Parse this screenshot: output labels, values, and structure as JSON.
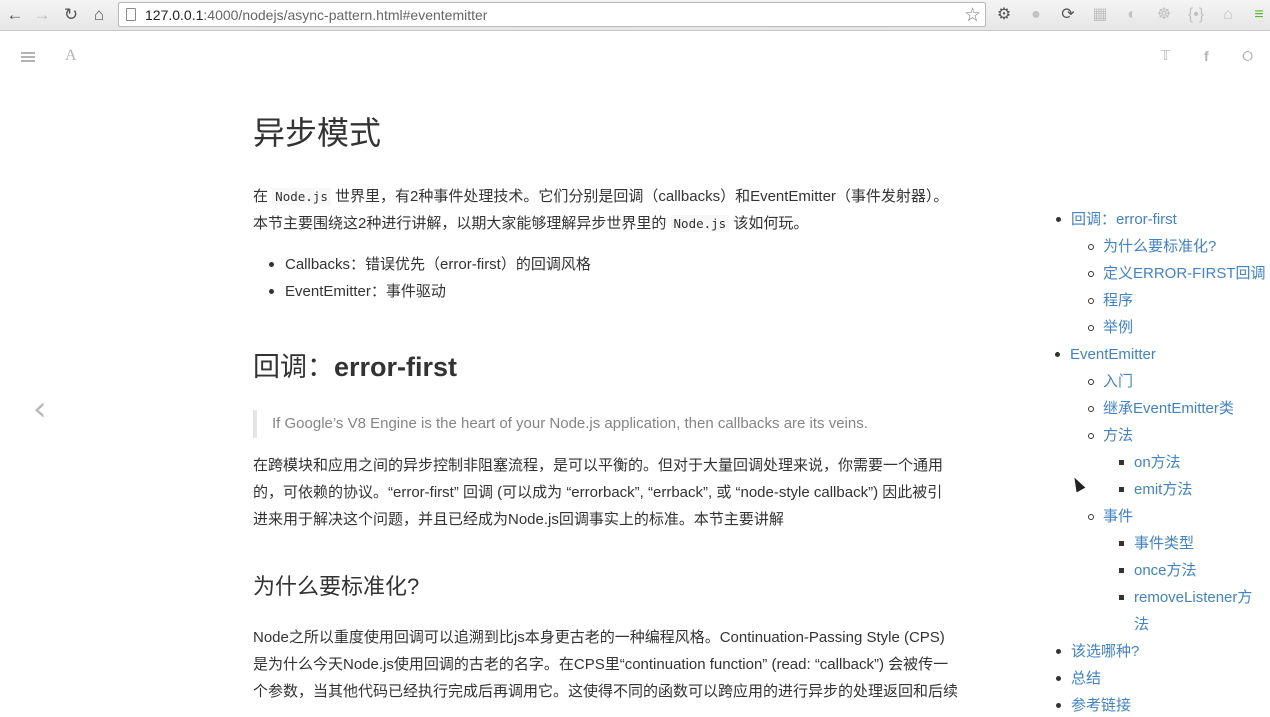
{
  "browser": {
    "url_host": "127.0.0.1",
    "url_rest": ":4000/nodejs/async-pattern.html#eventemitter",
    "nav_icons": [
      "back-arrow-icon",
      "forward-arrow-icon",
      "reload-icon",
      "home-icon"
    ],
    "extension_icons": [
      "gear-icon",
      "globe-icon",
      "sync-icon",
      "table-icon",
      "puzzle-icon",
      "settings-icon",
      "braces-icon",
      "hat-icon",
      "menu-icon"
    ]
  },
  "toolbar": {
    "left_icons": [
      "hamburger-menu-icon",
      "font-settings-icon"
    ],
    "right_icons": [
      "twitter-icon",
      "facebook-icon",
      "share-icon"
    ]
  },
  "article": {
    "title": "异步模式",
    "intro": {
      "line1_a": "在 ",
      "line1_code": "Node.js",
      "line1_b": " 世界里，有2种事件处理技术。它们分别是回调（callbacks）和EventEmitter（事件发射器）。",
      "line2_a": "本节主要围绕这2种进行讲解，以期大家能够理解异步世界里的 ",
      "line2_code": "Node.js",
      "line2_b": " 该如何玩。"
    },
    "bullets": [
      "Callbacks：错误优先（error-first）的回调风格",
      "EventEmitter：事件驱动"
    ],
    "section_heading_cn": "回调：",
    "section_heading_en": "error-first",
    "quote": "If Google’s V8 Engine is the heart of your Node.js application, then callbacks are its veins.",
    "para1": [
      "在跨模块和应用之间的异步控制非阻塞流程，是可以平衡的。但对于大量回调处理来说，你需要一个通用",
      "的，可依赖的协议。“error-first” 回调 (可以成为 “errorback”, “errback”, 或 “node-style callback”) 因此被引",
      "进来用于解决这个问题，并且已经成为Node.js回调事实上的标准。本节主要讲解"
    ],
    "subheading": "为什么要标准化?",
    "para2": [
      "Node之所以重度使用回调可以追溯到比js本身更古老的一种编程风格。Continuation-Passing Style (CPS)",
      "是为什么今天Node.js使用回调的古老的名字。在CPS里“continuation function” (read: “callback”) 会被传一",
      "个参数，当其他代码已经执行完成后再调用它。这使得不同的函数可以跨应用的进行异步的处理返回和后续"
    ]
  },
  "toc": [
    {
      "label": "回调：error-first",
      "level": 1
    },
    {
      "label": "为什么要标准化?",
      "level": 2
    },
    {
      "label": "定义ERROR-FIRST回调",
      "level": 2
    },
    {
      "label": "程序",
      "level": 2
    },
    {
      "label": "举例",
      "level": 2
    },
    {
      "label": "EventEmitter",
      "level": 1
    },
    {
      "label": "入门",
      "level": 2
    },
    {
      "label": "继承EventEmitter类",
      "level": 2
    },
    {
      "label": "方法",
      "level": 2
    },
    {
      "label": "on方法",
      "level": 3
    },
    {
      "label": "emit方法",
      "level": 3
    },
    {
      "label": "事件",
      "level": 2
    },
    {
      "label": "事件类型",
      "level": 3
    },
    {
      "label": "once方法",
      "level": 3
    },
    {
      "label": "removeListener方",
      "level": 3
    },
    {
      "label": "法",
      "level": 3
    },
    {
      "label": "该选哪种?",
      "level": 1
    },
    {
      "label": "总结",
      "level": 1
    },
    {
      "label": "参考链接",
      "level": 1
    }
  ],
  "colors": {
    "link": "#4183c4",
    "text": "#333333",
    "quote": "#858585"
  }
}
